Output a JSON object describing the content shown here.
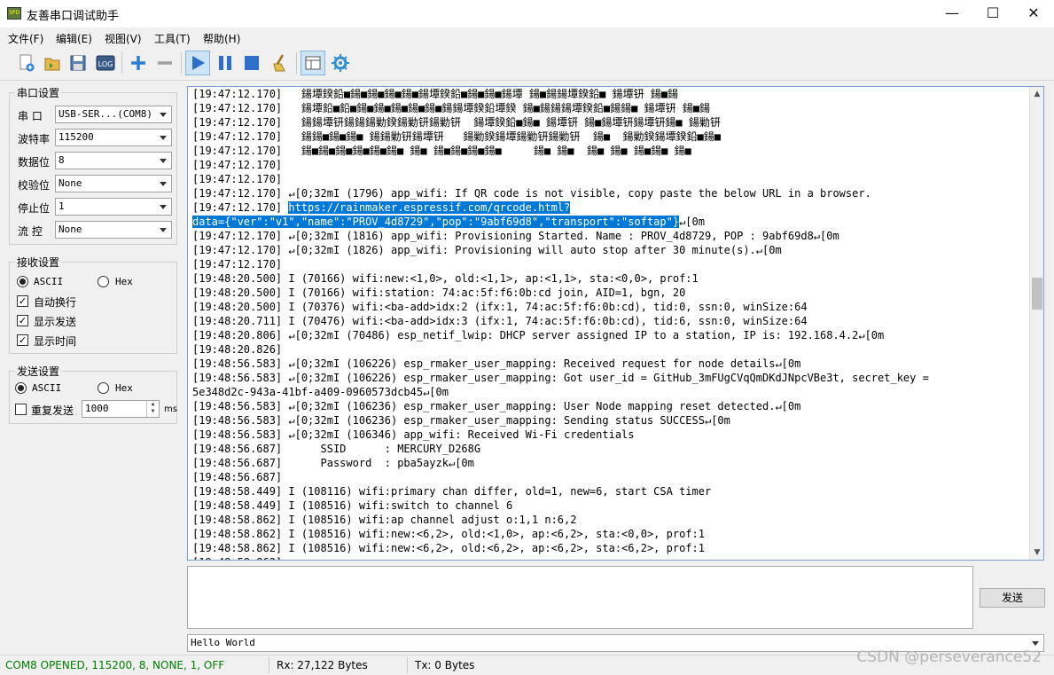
{
  "window": {
    "title": "友善串口调试助手",
    "icon_text": "SPD",
    "controls": [
      "minimize-icon",
      "maximize-icon",
      "close-icon"
    ]
  },
  "menu": [
    "文件(F)",
    "编辑(E)",
    "视图(V)",
    "工具(T)",
    "帮助(H)"
  ],
  "toolbar": {
    "log_label": "LOG",
    "icons": [
      "new-icon",
      "open-icon",
      "save-icon",
      "log-icon",
      "add-icon",
      "remove-icon",
      "play-icon",
      "pause-icon",
      "stop-icon",
      "clear-icon",
      "view-icon",
      "settings-icon"
    ]
  },
  "serial_settings": {
    "title": "串口设置",
    "port": {
      "label": "串  口",
      "value": "USB-SER...(COM8)"
    },
    "baud": {
      "label": "波特率",
      "value": "115200"
    },
    "databits": {
      "label": "数据位",
      "value": "8"
    },
    "parity": {
      "label": "校验位",
      "value": "None"
    },
    "stopbits": {
      "label": "停止位",
      "value": "1"
    },
    "flow": {
      "label": "流  控",
      "value": "None"
    }
  },
  "receive_settings": {
    "title": "接收设置",
    "ascii": "ASCII",
    "hex": "Hex",
    "auto_wrap": "自动换行",
    "show_send": "显示发送",
    "show_time": "显示时间"
  },
  "send_settings": {
    "title": "发送设置",
    "ascii": "ASCII",
    "hex": "Hex",
    "repeat": "重复发送",
    "interval": "1000",
    "unit": "ms"
  },
  "receive_lines": [
    "[19:47:12.170]   鍚墰鍨鉛■鍚■鍚■鍚■鍚■鍚墰鍨鉛■鍚■鍚■鍚墰 鍚■鍚鍚墰鍨鉛■ 鍚墰钘 鍚■鍚",
    "[19:47:12.170]   鍚墰鉛■鉛■鍚■鍚■鍚■鍚■鍚■鍚鍚墰鍨鉛墰鍨 鍚■鍚鍚鍚墰鍨鉛■鍚鍚■ 鍚墰钘 鍚■鍚",
    "[19:47:12.170]   鍚鍚墰钘鍚鍚鍚勦鍨鍚勦钘鍚勦钘  鍚墰鍨鉛■鍚■ 鍚墰钘 鍚■鍚墰钘鍚墰钘鍚■ 鍚勦钘",
    "[19:47:12.170]   鍚鍚■鍚■鍚■ 鍚鍚勦钘鍚墰钘   鍚勦鍨鍚墰鍚勦钘鍚勦钘  鍚■  鍚勦鍨鍚墰鍨鉛■鍚■",
    "[19:47:12.170]   鍚■鍚■鍚■鍚■鍚■鍚■ 鍚■ 鍚■鍚■鍚■鍚■     鍚■ 鍚■  鍚■ 鍚■ 鍚■鍚■ 鍚■",
    "[19:47:12.170]",
    "[19:47:12.170]",
    "[19:47:12.170] ↵[0;32mI (1796) app_wifi: If QR code is not visible, copy paste the below URL in a browser.",
    "[19:47:12.170] https://rainmaker.espressif.com/qrcode.html?",
    "data={\"ver\":\"v1\",\"name\":\"PROV_4d8729\",\"pop\":\"9abf69d8\",\"transport\":\"softap\"}↵[0m",
    "[19:47:12.170] ↵[0;32mI (1816) app_wifi: Provisioning Started. Name : PROV_4d8729, POP : 9abf69d8↵[0m",
    "[19:47:12.170] ↵[0;32mI (1826) app_wifi: Provisioning will auto stop after 30 minute(s).↵[0m",
    "[19:47:12.170]",
    "[19:48:20.500] I (70166) wifi:new:<1,0>, old:<1,1>, ap:<1,1>, sta:<0,0>, prof:1",
    "[19:48:20.500] I (70166) wifi:station: 74:ac:5f:f6:0b:cd join, AID=1, bgn, 20",
    "[19:48:20.500] I (70376) wifi:<ba-add>idx:2 (ifx:1, 74:ac:5f:f6:0b:cd), tid:0, ssn:0, winSize:64",
    "[19:48:20.711] I (70476) wifi:<ba-add>idx:3 (ifx:1, 74:ac:5f:f6:0b:cd), tid:6, ssn:0, winSize:64",
    "[19:48:20.806] ↵[0;32mI (70486) esp_netif_lwip: DHCP server assigned IP to a station, IP is: 192.168.4.2↵[0m",
    "[19:48:20.826]",
    "[19:48:56.583] ↵[0;32mI (106226) esp_rmaker_user_mapping: Received request for node details↵[0m",
    "[19:48:56.583] ↵[0;32mI (106226) esp_rmaker_user_mapping: Got user_id = GitHub_3mFUgCVqQmDKdJNpcVBe3t, secret_key =",
    "5e348d2c-943a-41bf-a409-0960573dcb45↵[0m",
    "[19:48:56.583] ↵[0;32mI (106236) esp_rmaker_user_mapping: User Node mapping reset detected.↵[0m",
    "[19:48:56.583] ↵[0;32mI (106236) esp_rmaker_user_mapping: Sending status SUCCESS↵[0m",
    "[19:48:56.583] ↵[0;32mI (106346) app_wifi: Received Wi-Fi credentials",
    "[19:48:56.687]      SSID      : MERCURY_D268G",
    "[19:48:56.687]      Password  : pba5ayzk↵[0m",
    "[19:48:56.687]",
    "[19:48:58.449] I (108116) wifi:primary chan differ, old=1, new=6, start CSA timer",
    "[19:48:58.449] I (108516) wifi:switch to channel 6",
    "[19:48:58.862] I (108516) wifi:ap channel adjust o:1,1 n:6,2",
    "[19:48:58.862] I (108516) wifi:new:<6,2>, old:<1,0>, ap:<6,2>, sta:<0,0>, prof:1",
    "[19:48:58.862] I (108516) wifi:new:<6,2>, old:<6,2>, ap:<6,2>, sta:<6,2>, prof:1",
    "[19:48:58.862]"
  ],
  "selection": {
    "line8_prefix": "[19:47:12.170] ",
    "line8_selected": "https://rainmaker.espressif.com/qrcode.html?",
    "line9_selected": "data={\"ver\":\"v1\",\"name\":\"PROV_4d8729\",\"pop\":\"9abf69d8\",\"transport\":\"softap\"}",
    "line9_rest": "↵[0m"
  },
  "send": {
    "text": "",
    "button_label": "发送",
    "history_value": "Hello World"
  },
  "status": {
    "connection": "COM8 OPENED, 115200, 8, NONE, 1, OFF",
    "rx": "Rx: 27,122 Bytes",
    "tx": "Tx: 0 Bytes",
    "connection_color": "#008000"
  },
  "watermark": "CSDN @perseverance52"
}
